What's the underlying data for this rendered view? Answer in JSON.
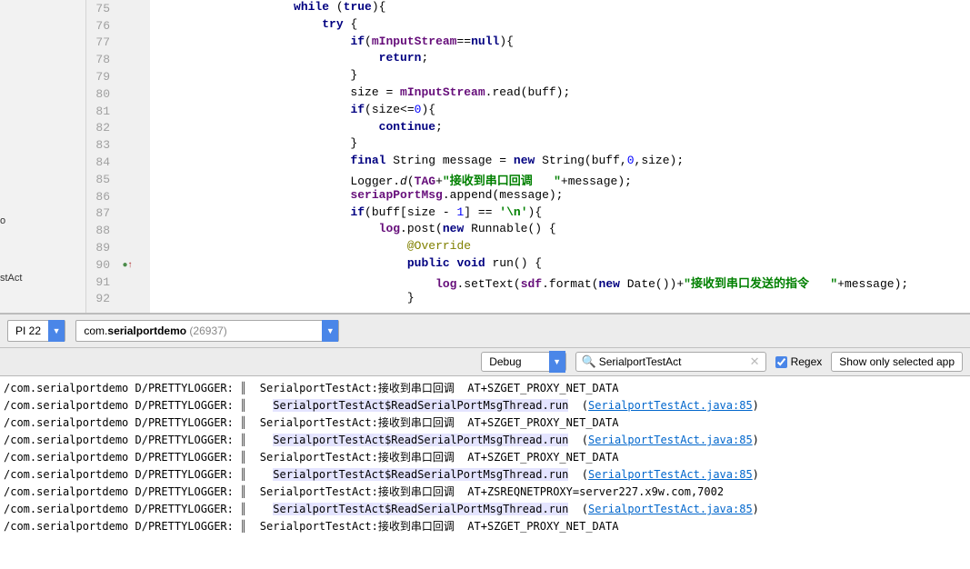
{
  "leftRail": {
    "text1": "o",
    "text2": "stAct"
  },
  "gutter": {
    "start": 75,
    "count": 18,
    "override_row": 90
  },
  "code": [
    {
      "i": "                    ",
      "t": [
        {
          "c": "kw",
          "v": "while"
        },
        {
          "v": " ("
        },
        {
          "c": "kw",
          "v": "true"
        },
        {
          "v": "){"
        }
      ]
    },
    {
      "i": "                        ",
      "t": [
        {
          "c": "kw",
          "v": "try"
        },
        {
          "v": " {"
        }
      ]
    },
    {
      "i": "                            ",
      "t": [
        {
          "c": "kw",
          "v": "if"
        },
        {
          "v": "("
        },
        {
          "c": "field",
          "v": "mInputStream"
        },
        {
          "v": "=="
        },
        {
          "c": "kw",
          "v": "null"
        },
        {
          "v": "){"
        }
      ]
    },
    {
      "i": "                                ",
      "t": [
        {
          "c": "kw",
          "v": "return"
        },
        {
          "v": ";"
        }
      ]
    },
    {
      "i": "                            ",
      "t": [
        {
          "v": "}"
        }
      ]
    },
    {
      "i": "                            ",
      "t": [
        {
          "v": "size = "
        },
        {
          "c": "field",
          "v": "mInputStream"
        },
        {
          "v": ".read(buff);"
        }
      ]
    },
    {
      "i": "                            ",
      "t": [
        {
          "c": "kw",
          "v": "if"
        },
        {
          "v": "(size<="
        },
        {
          "c": "num",
          "v": "0"
        },
        {
          "v": "){"
        }
      ]
    },
    {
      "i": "                                ",
      "t": [
        {
          "c": "kw",
          "v": "continue"
        },
        {
          "v": ";"
        }
      ]
    },
    {
      "i": "                            ",
      "t": [
        {
          "v": "}"
        }
      ]
    },
    {
      "i": "                            ",
      "t": [
        {
          "c": "kw",
          "v": "final"
        },
        {
          "v": " String message = "
        },
        {
          "c": "kw",
          "v": "new"
        },
        {
          "v": " String(buff,"
        },
        {
          "c": "num",
          "v": "0"
        },
        {
          "v": ",size);"
        }
      ]
    },
    {
      "i": "                            ",
      "t": [
        {
          "v": "Logger."
        },
        {
          "c": "method-static",
          "v": "d"
        },
        {
          "v": "("
        },
        {
          "c": "field",
          "v": "TAG"
        },
        {
          "v": "+"
        },
        {
          "c": "st",
          "v": "\"接收到串口回调   \""
        },
        {
          "v": "+message);"
        }
      ]
    },
    {
      "i": "                            ",
      "t": [
        {
          "c": "field",
          "v": "seriapPortMsg"
        },
        {
          "v": ".append(message);"
        }
      ]
    },
    {
      "i": "                            ",
      "t": [
        {
          "c": "kw",
          "v": "if"
        },
        {
          "v": "(buff[size - "
        },
        {
          "c": "num",
          "v": "1"
        },
        {
          "v": "] == "
        },
        {
          "c": "st",
          "v": "'\\n'"
        },
        {
          "v": "){"
        }
      ]
    },
    {
      "i": "                                ",
      "t": [
        {
          "c": "field",
          "v": "log"
        },
        {
          "v": ".post("
        },
        {
          "c": "kw",
          "v": "new"
        },
        {
          "v": " Runnable() {"
        }
      ]
    },
    {
      "i": "                                    ",
      "t": [
        {
          "c": "anno",
          "v": "@Override"
        }
      ]
    },
    {
      "i": "                                    ",
      "t": [
        {
          "c": "kw",
          "v": "public void"
        },
        {
          "v": " run() {"
        }
      ]
    },
    {
      "i": "                                        ",
      "t": [
        {
          "c": "field",
          "v": "log"
        },
        {
          "v": ".setText("
        },
        {
          "c": "field",
          "v": "sdf"
        },
        {
          "v": ".format("
        },
        {
          "c": "kw",
          "v": "new"
        },
        {
          "v": " Date())+"
        },
        {
          "c": "st",
          "v": "\"接收到串口发送的指令   \""
        },
        {
          "v": "+message);"
        }
      ]
    },
    {
      "i": "                                    ",
      "t": [
        {
          "v": "}"
        }
      ]
    }
  ],
  "toolbar": {
    "device_suffix": "PI 22",
    "process_prefix": "com.",
    "process_bold": "serialportdemo",
    "process_pid": " (26937)"
  },
  "filter": {
    "level": "Debug",
    "search_value": "SerialportTestAct",
    "mag_glyph": "🔍",
    "clear_glyph": "✕",
    "regex_label": "Regex",
    "show_only": "Show only selected app"
  },
  "logcat": {
    "pkg": "/com.serialportdemo D/PRETTYLOGGER:",
    "sep": "║",
    "callback_prefix": "SerialportTestAct:接收到串口回调  ",
    "read_thread": "SerialportTestAct$ReadSerialPortMsgThread.run",
    "link_text": "SerialportTestAct.java:85",
    "at_proxy": "AT+SZGET_PROXY_NET_DATA",
    "at_reqnet": "AT+ZSREQNETPROXY=server227.x9w.com,7002",
    "lines": [
      {
        "type": "callback",
        "at": "at_proxy"
      },
      {
        "type": "thread"
      },
      {
        "type": "callback",
        "at": "at_proxy"
      },
      {
        "type": "thread"
      },
      {
        "type": "callback",
        "at": "at_proxy"
      },
      {
        "type": "thread"
      },
      {
        "type": "callback",
        "at": "at_reqnet"
      },
      {
        "type": "thread"
      },
      {
        "type": "callback",
        "at": "at_proxy"
      }
    ]
  }
}
